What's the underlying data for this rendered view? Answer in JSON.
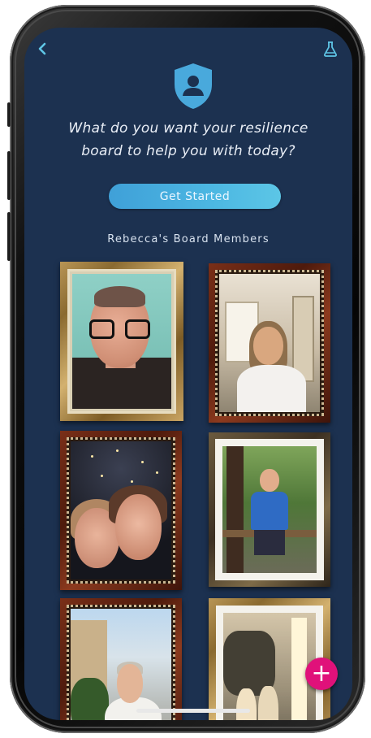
{
  "header": {
    "back_icon": "chevron-left-icon",
    "right_icon": "flask-icon",
    "badge_icon": "shield-user-icon"
  },
  "prompt": {
    "line1": "What do you want your resilience",
    "line2": "board to help you with today?"
  },
  "cta": {
    "label": "Get Started"
  },
  "board": {
    "title": "Rebecca's Board Members",
    "members": [
      {
        "frame": "gold"
      },
      {
        "frame": "wood"
      },
      {
        "frame": "wood"
      },
      {
        "frame": "dark"
      },
      {
        "frame": "wood"
      },
      {
        "frame": "gold"
      }
    ]
  },
  "fab": {
    "label": "+",
    "icon": "plus-icon"
  },
  "colors": {
    "background": "#1c3150",
    "accent": "#4cb7e2",
    "fab": "#e0117a",
    "text": "#e9eef6"
  }
}
